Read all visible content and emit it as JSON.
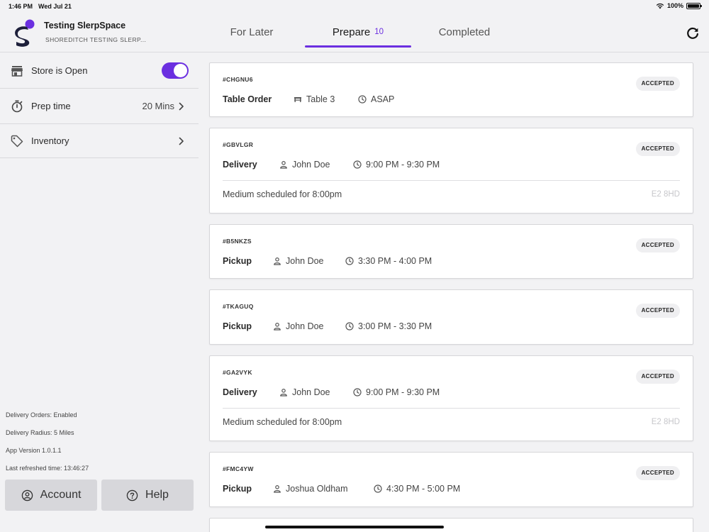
{
  "status_bar": {
    "time": "1:46 PM",
    "date": "Wed Jul 21",
    "battery": "100%"
  },
  "header": {
    "store_name": "Testing SlerpSpace",
    "store_sub": "SHOREDITCH TESTING SLERP...",
    "brand_color": "#6b2fe0",
    "tabs": [
      {
        "label": "For Later",
        "count": ""
      },
      {
        "label": "Prepare",
        "count": "10"
      },
      {
        "label": "Completed",
        "count": ""
      }
    ],
    "active_tab": "Prepare"
  },
  "sidebar": {
    "store_open": {
      "label": "Store is Open",
      "enabled": true
    },
    "prep_time": {
      "label": "Prep time",
      "value": "20 Mins"
    },
    "inventory": {
      "label": "Inventory"
    },
    "info": {
      "delivery_orders": "Delivery Orders: Enabled",
      "delivery_radius": "Delivery Radius: 5 Miles",
      "app_version": "App Version 1.0.1.1",
      "last_refreshed": "Last refreshed time: 13:46:27"
    },
    "account_label": "Account",
    "help_label": "Help"
  },
  "orders": [
    {
      "id": "#CHGNU6",
      "type": "Table Order",
      "who_icon": "table-icon",
      "who": "Table 3",
      "time": "ASAP",
      "status": "ACCEPTED"
    },
    {
      "id": "#GBVLGR",
      "type": "Delivery",
      "who_icon": "person-icon",
      "who": "John Doe",
      "time": "9:00 PM - 9:30 PM",
      "status": "ACCEPTED",
      "note": "Medium scheduled for 8:00pm",
      "postcode": "E2 8HD"
    },
    {
      "id": "#B5NKZS",
      "type": "Pickup",
      "who_icon": "person-icon",
      "who": "John Doe",
      "time": "3:30 PM - 4:00 PM",
      "status": "ACCEPTED"
    },
    {
      "id": "#TKAGUQ",
      "type": "Pickup",
      "who_icon": "person-icon",
      "who": "John Doe",
      "time": "3:00 PM - 3:30 PM",
      "status": "ACCEPTED"
    },
    {
      "id": "#GA2VYK",
      "type": "Delivery",
      "who_icon": "person-icon",
      "who": "John Doe",
      "time": "9:00 PM - 9:30 PM",
      "status": "ACCEPTED",
      "note": "Medium scheduled for 8:00pm",
      "postcode": "E2 8HD"
    },
    {
      "id": "#FMC4YW",
      "type": "Pickup",
      "who_icon": "person-icon",
      "who": "Joshua Oldham",
      "time": "4:30 PM - 5:00 PM",
      "status": "ACCEPTED"
    }
  ]
}
